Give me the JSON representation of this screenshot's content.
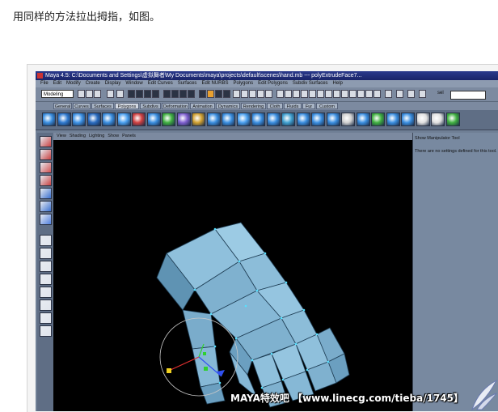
{
  "caption": "用同样的方法拉出拇指，如图。",
  "window": {
    "title": "Maya 4.5: C:\\Documents and Settings\\虚拟舞者\\My Documents\\maya\\projects\\default\\scenes\\hand.mb  ---  polyExtrudeFace7..."
  },
  "menubar": [
    "File",
    "Edit",
    "Modify",
    "Create",
    "Display",
    "Window",
    "Edit Curves",
    "Surfaces",
    "Edit NURBS",
    "Polygons",
    "Edit Polygons",
    "Subdiv Surfaces",
    "Help"
  ],
  "status_line": {
    "mode": "Modeling",
    "sel_label": "sel"
  },
  "shelf_tabs": [
    {
      "label": "General",
      "active": false
    },
    {
      "label": "Curves",
      "active": false
    },
    {
      "label": "Surfaces",
      "active": false
    },
    {
      "label": "Polygons",
      "active": true
    },
    {
      "label": "Subdivs",
      "active": false
    },
    {
      "label": "Deformation",
      "active": false
    },
    {
      "label": "Animation",
      "active": false
    },
    {
      "label": "Dynamics",
      "active": false
    },
    {
      "label": "Rendering",
      "active": false
    },
    {
      "label": "Cloth",
      "active": false
    },
    {
      "label": "Fluids",
      "active": false
    },
    {
      "label": "Fur",
      "active": false
    },
    {
      "label": "Custom",
      "active": false
    }
  ],
  "panel_menu": [
    "View",
    "Shading",
    "Lighting",
    "Show",
    "Panels"
  ],
  "attribute_editor": {
    "title": "Show Manipulator Tool",
    "message": "There are no settings defined for this tool."
  },
  "watermark": "MAYA特效吧 【www.linecg.com/tieba/1745】",
  "colors": {
    "viewport_bg": "#000000",
    "mesh": "#8fc0dc",
    "mesh_edge": "#1f3e55",
    "vertex": "#57e0ff",
    "title_bar": "#1f2c7a",
    "ui_bg": "#7c8aa0"
  }
}
